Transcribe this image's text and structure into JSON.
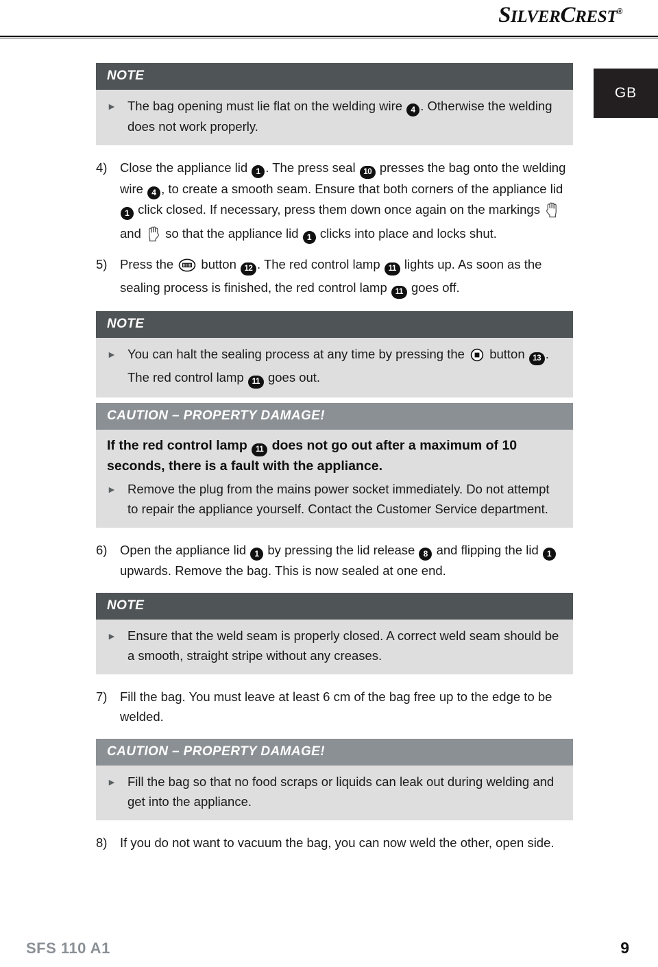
{
  "brand": {
    "name_part1": "S",
    "name_part2": "ILVER",
    "name_part3": "C",
    "name_part4": "REST",
    "registered": "®"
  },
  "language_tab": {
    "label": "GB"
  },
  "callouts": {
    "note_label": "NOTE",
    "caution_label": "CAUTION – PROPERTY DAMAGE!",
    "bullet_marker": "►"
  },
  "note1": {
    "heading": "NOTE",
    "bullet_1_a": "The bag opening must lie flat on the welding wire ",
    "bullet_1_ref": "4",
    "bullet_1_b": ". Otherwise the welding does not work properly."
  },
  "step4": {
    "number": "4)",
    "t1": "Close the appliance lid ",
    "r1": "1",
    "t2": ". The press seal ",
    "r2": "10",
    "t3": " presses the bag onto the welding wire ",
    "r3": "4",
    "t4": ", to create a smooth seam. Ensure that both corners of the appliance lid ",
    "r4": "1",
    "t5": " click closed. If necessary, press them down once again on the markings ",
    "t6": " and ",
    "t7": " so that the appliance lid ",
    "r5": "1",
    "t8": " clicks into place and locks shut."
  },
  "step5": {
    "number": "5)",
    "t1": "Press the ",
    "t2": " button ",
    "r1": "12",
    "t3": ". The red control lamp ",
    "r2": "11",
    "t4": " lights up. As soon as the sealing process is finished, the red control lamp ",
    "r3": "11",
    "t5": " goes off."
  },
  "note2": {
    "heading": "NOTE",
    "t1": "You can halt the sealing process at any time by pressing the ",
    "t2": " button ",
    "r1": "13",
    "t3": ". The red control lamp ",
    "r2": "11",
    "t4": " goes out."
  },
  "caution1": {
    "heading": "CAUTION – PROPERTY DAMAGE!",
    "lead_a": "If the red control lamp ",
    "lead_ref": "11",
    "lead_b": " does not go out after a maximum of 10 seconds, there is a fault with the appliance.",
    "bullet": "Remove the plug from the mains power socket immediately. Do not attempt to repair the appliance yourself. Contact the Customer Service department."
  },
  "step6": {
    "number": "6)",
    "t1": "Open the appliance lid ",
    "r1": "1",
    "t2": " by pressing the lid release ",
    "r2": "8",
    "t3": " and flipping the lid ",
    "r3": "1",
    "t4": " upwards. Remove the bag. This is now sealed at one end."
  },
  "note3": {
    "heading": "NOTE",
    "bullet": "Ensure that the weld seam is properly closed. A correct weld seam should be a smooth, straight stripe without any creases."
  },
  "step7": {
    "number": "7)",
    "text": "Fill the bag. You must leave at least 6 cm of the bag free up to the edge to be welded."
  },
  "caution2": {
    "heading": "CAUTION – PROPERTY DAMAGE!",
    "bullet": "Fill the bag so that no food scraps or liquids can leak out during welding and get into the appliance."
  },
  "step8": {
    "number": "8)",
    "text": "If you do not want to vacuum the bag, you can now weld the other, open side."
  },
  "footer": {
    "model": "SFS 110 A1",
    "page": "9"
  },
  "colors": {
    "note_header_bg": "#4f5456",
    "caution_header_bg": "#8b9094",
    "callout_body_bg": "#dedede",
    "lang_tab_bg": "#231f20",
    "footer_model": "#8a9096",
    "text": "#1a1a1a"
  }
}
